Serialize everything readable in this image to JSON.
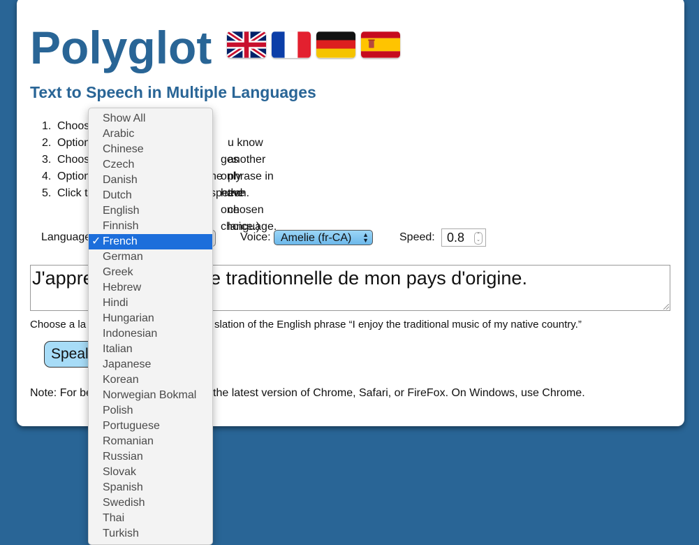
{
  "header": {
    "title": "Polyglot",
    "subtitle": "Text to Speech in Multiple Languages",
    "flags": [
      "uk-flag-icon",
      "france-flag-icon",
      "germany-flag-icon",
      "spain-flag-icon"
    ]
  },
  "steps": [
    {
      "num": "1.",
      "visible_text": "Choos"
    },
    {
      "num": "2.",
      "visible_text": "Option",
      "tail": "u know another phrase in the chosen language."
    },
    {
      "num": "3.",
      "visible_text": "Choos",
      "tail": "ges only have one choice.)"
    },
    {
      "num": "4.",
      "visible_text": "Option",
      "tail": "ne speech."
    },
    {
      "num": "5.",
      "visible_text": "Click t"
    }
  ],
  "controls": {
    "language_label": "Language",
    "voice_label": "Voice:",
    "voice_value": "Amelie (fr-CA)",
    "speed_label": "Speed:",
    "speed_value": "0.8"
  },
  "phrase": {
    "visible_start": "J'appre",
    "visible_end": "ue traditionnelle de mon pays d'origine."
  },
  "hint": {
    "visible_start": "Choose a la",
    "visible_end": "slation of the English phrase “I enjoy the traditional music of my native country.”"
  },
  "speak_button": {
    "visible_text": "Speal"
  },
  "note": {
    "visible_start": "Note: For be",
    "visible_end": "the latest version of Chrome, Safari, or FireFox. On Windows, use Chrome."
  },
  "language_dropdown": {
    "selected": "French",
    "check_mark": "✓",
    "options": [
      "Show All",
      "Arabic",
      "Chinese",
      "Czech",
      "Danish",
      "Dutch",
      "English",
      "Finnish",
      "French",
      "German",
      "Greek",
      "Hebrew",
      "Hindi",
      "Hungarian",
      "Indonesian",
      "Italian",
      "Japanese",
      "Korean",
      "Norwegian Bokmal",
      "Polish",
      "Portuguese",
      "Romanian",
      "Russian",
      "Slovak",
      "Spanish",
      "Swedish",
      "Thai",
      "Turkish"
    ]
  },
  "colors": {
    "page_background": "#296596",
    "brand_blue": "#296596",
    "button_blue": "#a7dcf7",
    "selection_blue": "#1c6edb"
  }
}
